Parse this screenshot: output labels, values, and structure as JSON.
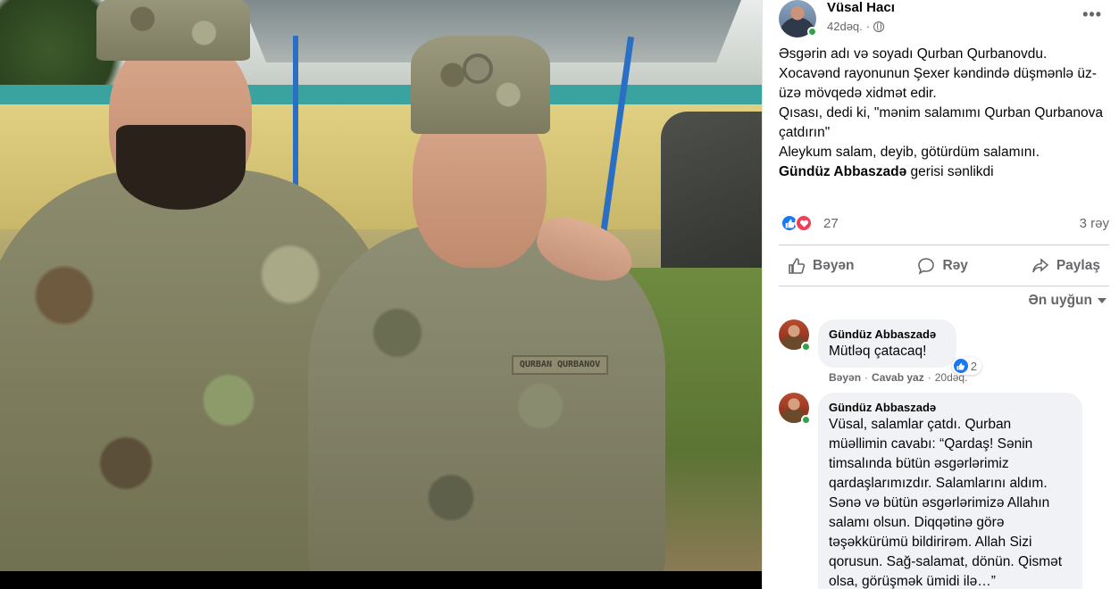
{
  "photo": {
    "nametag_text": "QURBAN QURBANOV"
  },
  "post": {
    "author": "Vüsal Hacı",
    "time": "42dəq.",
    "more": "•••",
    "text_lines": [
      "Əsgərin adı və soyadı Qurban Qurbanovdu.",
      "Xocavənd rayonunun Şexer kəndində düşmənlə üz-üzə mövqedə xidmət edir.",
      "Qısası, dedi ki, \"mənim salamımı Qurban Qurbanova çatdırın\"",
      "Aleykum salam, deyib, götürdüm salamını."
    ],
    "mention": "Gündüz Abbaszadə",
    "mention_suffix": " gerisi sənlikdi",
    "reaction_count": "27",
    "comment_count": "3 rəy"
  },
  "actions": {
    "like": "Bəyən",
    "comment": "Rəy",
    "share": "Paylaş"
  },
  "sort_label": "Ən uyğun",
  "comments": [
    {
      "name": "Gündüz Abbaszadə",
      "text": "Mütləq çatacaq!",
      "reaction_count": "2",
      "like": "Bəyən",
      "reply": "Cavab yaz",
      "time": "20dəq."
    },
    {
      "name": "Gündüz Abbaszadə",
      "text": "Vüsal, salamlar çatdı. Qurban müəllimin cavabı: “Qardaş! Sənin timsalında bütün əsgərlərimiz qardaşlarımızdır. Salamlarını aldım. Sənə və bütün əsgərlərimizə Allahın salamı olsun. Diqqətinə görə təşəkkürümü bildirirəm. Allah Sizi qorusun. Sağ-salamat, dönün. Qismət olsa, görüşmək ümidi ilə…”"
    }
  ],
  "colors": {
    "like_blue": "#1877f2",
    "love_red": "#f33e58",
    "online_green": "#31a24c",
    "muted_text": "#65676b"
  }
}
